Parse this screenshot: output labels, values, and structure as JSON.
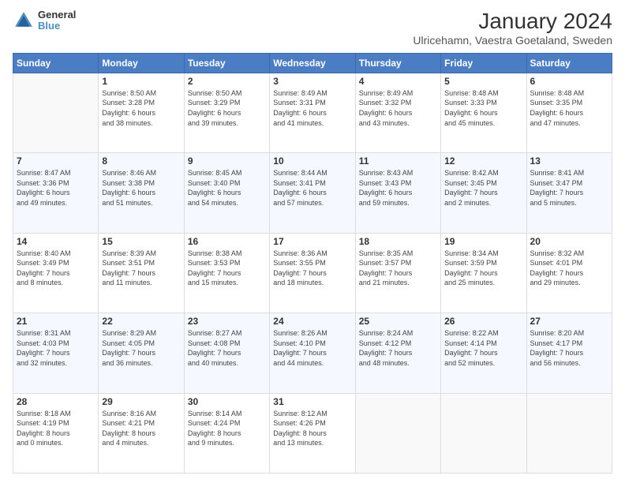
{
  "header": {
    "logo_text_top": "General",
    "logo_text_bottom": "Blue",
    "title": "January 2024",
    "subtitle": "Ulricehamn, Vaestra Goetaland, Sweden"
  },
  "days_of_week": [
    "Sunday",
    "Monday",
    "Tuesday",
    "Wednesday",
    "Thursday",
    "Friday",
    "Saturday"
  ],
  "weeks": [
    [
      {
        "day": "",
        "info": ""
      },
      {
        "day": "1",
        "info": "Sunrise: 8:50 AM\nSunset: 3:28 PM\nDaylight: 6 hours\nand 38 minutes."
      },
      {
        "day": "2",
        "info": "Sunrise: 8:50 AM\nSunset: 3:29 PM\nDaylight: 6 hours\nand 39 minutes."
      },
      {
        "day": "3",
        "info": "Sunrise: 8:49 AM\nSunset: 3:31 PM\nDaylight: 6 hours\nand 41 minutes."
      },
      {
        "day": "4",
        "info": "Sunrise: 8:49 AM\nSunset: 3:32 PM\nDaylight: 6 hours\nand 43 minutes."
      },
      {
        "day": "5",
        "info": "Sunrise: 8:48 AM\nSunset: 3:33 PM\nDaylight: 6 hours\nand 45 minutes."
      },
      {
        "day": "6",
        "info": "Sunrise: 8:48 AM\nSunset: 3:35 PM\nDaylight: 6 hours\nand 47 minutes."
      }
    ],
    [
      {
        "day": "7",
        "info": "Sunrise: 8:47 AM\nSunset: 3:36 PM\nDaylight: 6 hours\nand 49 minutes."
      },
      {
        "day": "8",
        "info": "Sunrise: 8:46 AM\nSunset: 3:38 PM\nDaylight: 6 hours\nand 51 minutes."
      },
      {
        "day": "9",
        "info": "Sunrise: 8:45 AM\nSunset: 3:40 PM\nDaylight: 6 hours\nand 54 minutes."
      },
      {
        "day": "10",
        "info": "Sunrise: 8:44 AM\nSunset: 3:41 PM\nDaylight: 6 hours\nand 57 minutes."
      },
      {
        "day": "11",
        "info": "Sunrise: 8:43 AM\nSunset: 3:43 PM\nDaylight: 6 hours\nand 59 minutes."
      },
      {
        "day": "12",
        "info": "Sunrise: 8:42 AM\nSunset: 3:45 PM\nDaylight: 7 hours\nand 2 minutes."
      },
      {
        "day": "13",
        "info": "Sunrise: 8:41 AM\nSunset: 3:47 PM\nDaylight: 7 hours\nand 5 minutes."
      }
    ],
    [
      {
        "day": "14",
        "info": "Sunrise: 8:40 AM\nSunset: 3:49 PM\nDaylight: 7 hours\nand 8 minutes."
      },
      {
        "day": "15",
        "info": "Sunrise: 8:39 AM\nSunset: 3:51 PM\nDaylight: 7 hours\nand 11 minutes."
      },
      {
        "day": "16",
        "info": "Sunrise: 8:38 AM\nSunset: 3:53 PM\nDaylight: 7 hours\nand 15 minutes."
      },
      {
        "day": "17",
        "info": "Sunrise: 8:36 AM\nSunset: 3:55 PM\nDaylight: 7 hours\nand 18 minutes."
      },
      {
        "day": "18",
        "info": "Sunrise: 8:35 AM\nSunset: 3:57 PM\nDaylight: 7 hours\nand 21 minutes."
      },
      {
        "day": "19",
        "info": "Sunrise: 8:34 AM\nSunset: 3:59 PM\nDaylight: 7 hours\nand 25 minutes."
      },
      {
        "day": "20",
        "info": "Sunrise: 8:32 AM\nSunset: 4:01 PM\nDaylight: 7 hours\nand 29 minutes."
      }
    ],
    [
      {
        "day": "21",
        "info": "Sunrise: 8:31 AM\nSunset: 4:03 PM\nDaylight: 7 hours\nand 32 minutes."
      },
      {
        "day": "22",
        "info": "Sunrise: 8:29 AM\nSunset: 4:05 PM\nDaylight: 7 hours\nand 36 minutes."
      },
      {
        "day": "23",
        "info": "Sunrise: 8:27 AM\nSunset: 4:08 PM\nDaylight: 7 hours\nand 40 minutes."
      },
      {
        "day": "24",
        "info": "Sunrise: 8:26 AM\nSunset: 4:10 PM\nDaylight: 7 hours\nand 44 minutes."
      },
      {
        "day": "25",
        "info": "Sunrise: 8:24 AM\nSunset: 4:12 PM\nDaylight: 7 hours\nand 48 minutes."
      },
      {
        "day": "26",
        "info": "Sunrise: 8:22 AM\nSunset: 4:14 PM\nDaylight: 7 hours\nand 52 minutes."
      },
      {
        "day": "27",
        "info": "Sunrise: 8:20 AM\nSunset: 4:17 PM\nDaylight: 7 hours\nand 56 minutes."
      }
    ],
    [
      {
        "day": "28",
        "info": "Sunrise: 8:18 AM\nSunset: 4:19 PM\nDaylight: 8 hours\nand 0 minutes."
      },
      {
        "day": "29",
        "info": "Sunrise: 8:16 AM\nSunset: 4:21 PM\nDaylight: 8 hours\nand 4 minutes."
      },
      {
        "day": "30",
        "info": "Sunrise: 8:14 AM\nSunset: 4:24 PM\nDaylight: 8 hours\nand 9 minutes."
      },
      {
        "day": "31",
        "info": "Sunrise: 8:12 AM\nSunset: 4:26 PM\nDaylight: 8 hours\nand 13 minutes."
      },
      {
        "day": "",
        "info": ""
      },
      {
        "day": "",
        "info": ""
      },
      {
        "day": "",
        "info": ""
      }
    ]
  ]
}
